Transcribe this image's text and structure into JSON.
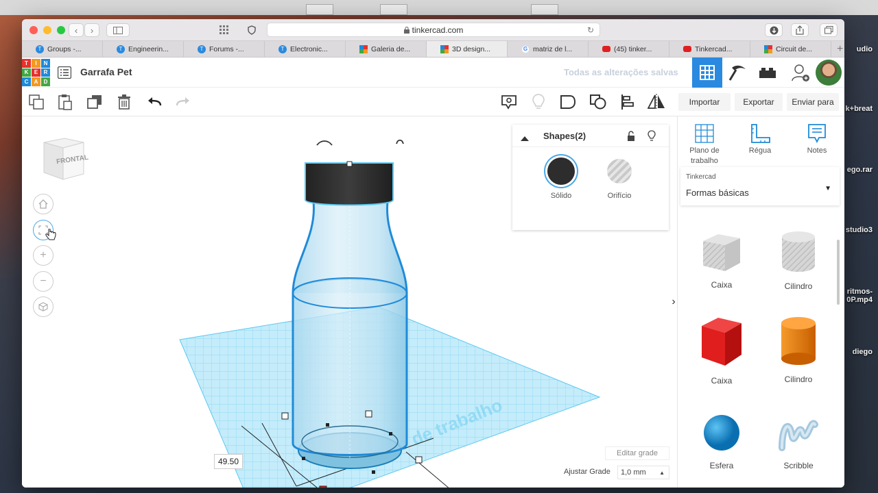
{
  "desktop": {
    "labels": [
      "udio",
      "k+breat",
      "ego.rar",
      "studio3",
      "ritmos-\n0P.mp4",
      "diego"
    ]
  },
  "browser": {
    "url": "tinkercad.com",
    "tabs": [
      {
        "label": "Groups -...",
        "icon": "tinkercad-icon"
      },
      {
        "label": "Engineerin...",
        "icon": "tinkercad-icon"
      },
      {
        "label": "Forums -...",
        "icon": "tinkercad-icon"
      },
      {
        "label": "Electronic...",
        "icon": "tinkercad-icon"
      },
      {
        "label": "Galeria de...",
        "icon": "grid-icon"
      },
      {
        "label": "3D design...",
        "icon": "grid-icon"
      },
      {
        "label": "matriz de l...",
        "icon": "google-icon"
      },
      {
        "label": "(45) tinker...",
        "icon": "youtube-icon"
      },
      {
        "label": "Tinkercad...",
        "icon": "youtube-icon"
      },
      {
        "label": "Circuit de...",
        "icon": "grid-icon"
      }
    ]
  },
  "app": {
    "logo_letters": [
      "TIN",
      "KER",
      "CAD"
    ],
    "design_title": "Garrafa Pet",
    "saved_status": "Todas as alterações salvas"
  },
  "toolbar": {
    "import": "Importar",
    "export": "Exportar",
    "send": "Enviar para"
  },
  "viewcube": {
    "face": "FRONTAL"
  },
  "shapes_panel": {
    "title": "Shapes(2)",
    "solid": "Sólido",
    "hole": "Orifício"
  },
  "workspace": {
    "dimension": "49.50",
    "edit_grid": "Editar grade",
    "adjust_grid": "Ajustar Grade",
    "grid_value": "1,0 mm",
    "plane_text": "Plano de trabalho"
  },
  "right_panel": {
    "tools": [
      "Plano de trabalho",
      "Régua",
      "Notes"
    ],
    "library_small": "Tinkercad",
    "library_main": "Formas básicas",
    "shapes": [
      {
        "label": "Caixa",
        "kind": "box-hole"
      },
      {
        "label": "Cilindro",
        "kind": "cylinder-hole"
      },
      {
        "label": "Caixa",
        "kind": "box-red"
      },
      {
        "label": "Cilindro",
        "kind": "cylinder-orange"
      },
      {
        "label": "Esfera",
        "kind": "sphere-blue"
      },
      {
        "label": "Scribble",
        "kind": "scribble"
      }
    ]
  },
  "colors": {
    "accent_blue": "#2a8adf",
    "grid_blue": "#5cc8f0",
    "solid_dark": "#2d2d2d",
    "box_red": "#e01e1e",
    "cylinder_orange": "#f07c00",
    "sphere_blue": "#1a8fd8",
    "logo_red": "#e8322b",
    "logo_orange": "#f39a21",
    "logo_blue": "#1f8ad8",
    "logo_green": "#42a845"
  }
}
